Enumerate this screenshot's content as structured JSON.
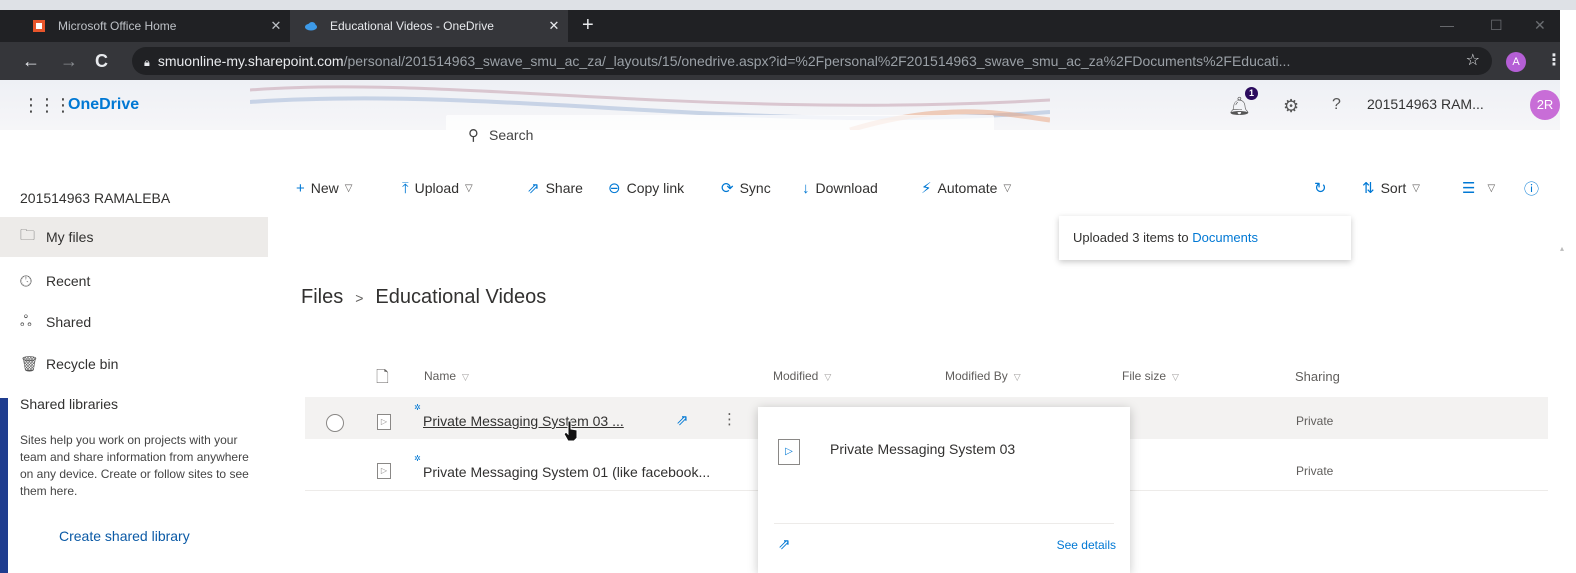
{
  "browser": {
    "tabs": [
      {
        "title": "Microsoft Office Home",
        "active": false,
        "icon": "office-icon"
      },
      {
        "title": "Educational Videos - OneDrive",
        "active": true,
        "icon": "onedrive-cloud-icon"
      }
    ],
    "url_host": "smuonline-my.sharepoint.com",
    "url_path": "/personal/201514963_swave_smu_ac_za/_layouts/15/onedrive.aspx?id=%2Fpersonal%2F201514963_swave_smu_ac_za%2FDocuments%2FEducati...",
    "profile_initial": "A"
  },
  "suite": {
    "app_name": "OneDrive",
    "search_placeholder": "Search",
    "notification_count": "1",
    "user_name": "201514963 RAM...",
    "avatar_initials": "2R"
  },
  "nav": {
    "account": "201514963 RAMALEBA",
    "items": [
      {
        "label": "My files",
        "icon": "folder-icon",
        "selected": true
      },
      {
        "label": "Recent",
        "icon": "clock-icon",
        "selected": false
      },
      {
        "label": "Shared",
        "icon": "people-icon",
        "selected": false
      },
      {
        "label": "Recycle bin",
        "icon": "trash-icon",
        "selected": false
      }
    ],
    "shared_libraries_title": "Shared libraries",
    "shared_libraries_desc": "Sites help you work on projects with your team and share information from anywhere on any device. Create or follow sites to see them here.",
    "create_library": "Create shared library"
  },
  "commands": {
    "new": "New",
    "upload": "Upload",
    "share": "Share",
    "copy_link": "Copy link",
    "sync": "Sync",
    "download": "Download",
    "automate": "Automate",
    "sort": "Sort"
  },
  "notification": {
    "text": "Uploaded 3 items to ",
    "link": "Documents"
  },
  "breadcrumb": {
    "root": "Files",
    "separator": ">",
    "current": "Educational Videos"
  },
  "columns": {
    "name": "Name",
    "modified": "Modified",
    "modified_by": "Modified By",
    "file_size": "File size",
    "sharing": "Sharing"
  },
  "files": [
    {
      "name": "Private Messaging System 03 ...",
      "sharing": "Private"
    },
    {
      "name": "Private Messaging System 01 (like facebook...",
      "sharing": "Private"
    }
  ],
  "hover_card": {
    "title": "Private Messaging System 03",
    "see_details": "See details"
  },
  "colors": {
    "accent": "#0078d4",
    "chrome_dark": "#202124",
    "selected_row": "#f3f2f1"
  }
}
